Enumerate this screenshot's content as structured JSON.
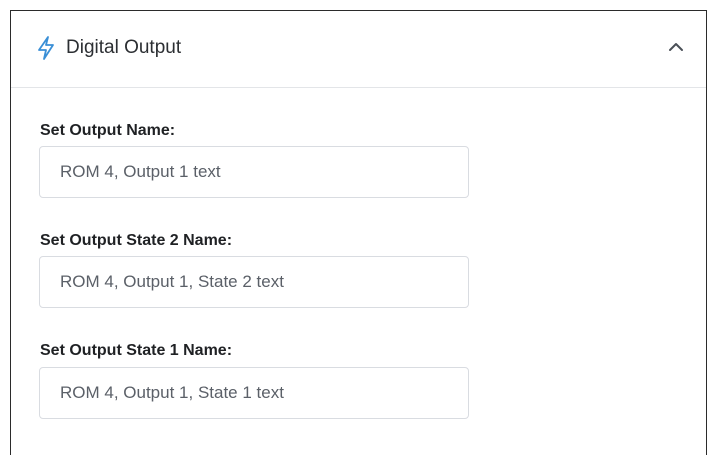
{
  "panel": {
    "title": "Digital Output",
    "icon": "lightning-bolt-icon",
    "collapse_icon": "chevron-up-icon",
    "accent_color": "#3a8fd6"
  },
  "fields": [
    {
      "label": "Set Output Name:",
      "value": "ROM 4, Output 1 text"
    },
    {
      "label": "Set Output State 2 Name:",
      "value": "ROM 4, Output 1, State 2 text"
    },
    {
      "label": "Set Output State 1 Name:",
      "value": "ROM 4, Output 1, State 1 text"
    }
  ]
}
